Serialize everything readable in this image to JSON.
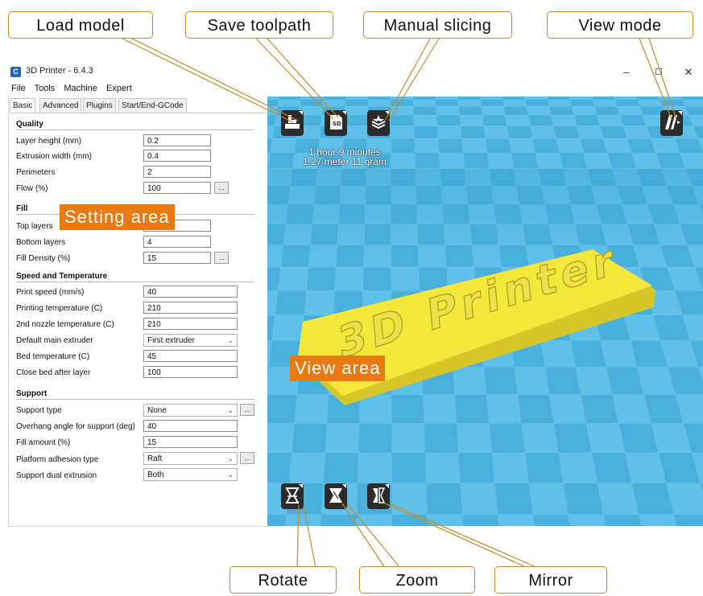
{
  "window": {
    "app_title": "3D Printer - 6.4.3",
    "icon_letter": "C",
    "controls": {
      "minimize": "–",
      "maximize": "☐",
      "close": "✕"
    }
  },
  "menu": [
    "File",
    "Tools",
    "Machine",
    "Expert"
  ],
  "tabs": [
    "Basic",
    "Advanced",
    "Plugins",
    "Start/End-GCode"
  ],
  "sections": {
    "quality": {
      "title": "Quality",
      "layer_height": {
        "label": "Layer height (mm)",
        "value": "0.2"
      },
      "extrusion_width": {
        "label": "Extrusion width (mm)",
        "value": "0.4"
      },
      "perimeters": {
        "label": "Perimeters",
        "value": "2"
      },
      "flow": {
        "label": "Flow (%)",
        "value": "100"
      }
    },
    "fill": {
      "title": "Fill",
      "top_layers": {
        "label": "Top layers",
        "value": ""
      },
      "bottom_layers": {
        "label": "Bottom layers",
        "value": "4"
      },
      "fill_density": {
        "label": "Fill Density (%)",
        "value": "15"
      }
    },
    "speed": {
      "title": "Speed and Temperature",
      "print_speed": {
        "label": "Print speed (mm/s)",
        "value": "40"
      },
      "print_temp": {
        "label": "Printing temperature (C)",
        "value": "210"
      },
      "nozzle2_temp": {
        "label": "2nd nozzle temperature (C)",
        "value": "210"
      },
      "main_extruder": {
        "label": "Default main extruder",
        "value": "First extruder"
      },
      "bed_temp": {
        "label": "Bed temperature (C)",
        "value": "45"
      },
      "close_bed": {
        "label": "Close bed after layer",
        "value": "100"
      }
    },
    "support": {
      "title": "Support",
      "support_type": {
        "label": "Support type",
        "value": "None"
      },
      "overhang": {
        "label": "Overhang angle for support (deg)",
        "value": "40"
      },
      "fill_amount": {
        "label": "Fill amount (%)",
        "value": "15"
      },
      "adhesion": {
        "label": "Platform adhesion type",
        "value": "Raft"
      },
      "dual_extrusion": {
        "label": "Support dual extrusion",
        "value": "Both"
      }
    },
    "more_button": "..."
  },
  "view": {
    "print_time": "1 hour 9 minutes",
    "print_usage": "1.27 meter 11 gram",
    "model_text": "3D Printer",
    "colors": {
      "floor": "#5fc0ea",
      "floor_alt": "#49b0dd",
      "sky": "#e4e4e4",
      "model": "#f6e83a"
    },
    "tool_icons": [
      "load-model-icon",
      "save-toolpath-icon",
      "manual-slicing-icon",
      "view-mode-icon",
      "rotate-icon",
      "zoom-icon",
      "mirror-icon"
    ]
  },
  "annotations": {
    "load_model": "Load model",
    "save_toolpath": "Save toolpath",
    "manual_slicing": "Manual slicing",
    "view_mode": "View mode",
    "setting_area": "Setting area",
    "view_area": "View area",
    "rotate": "Rotate",
    "zoom": "Zoom",
    "mirror": "Mirror",
    "callout_border": "#c58a2c",
    "tag_color": "#e87a14"
  }
}
